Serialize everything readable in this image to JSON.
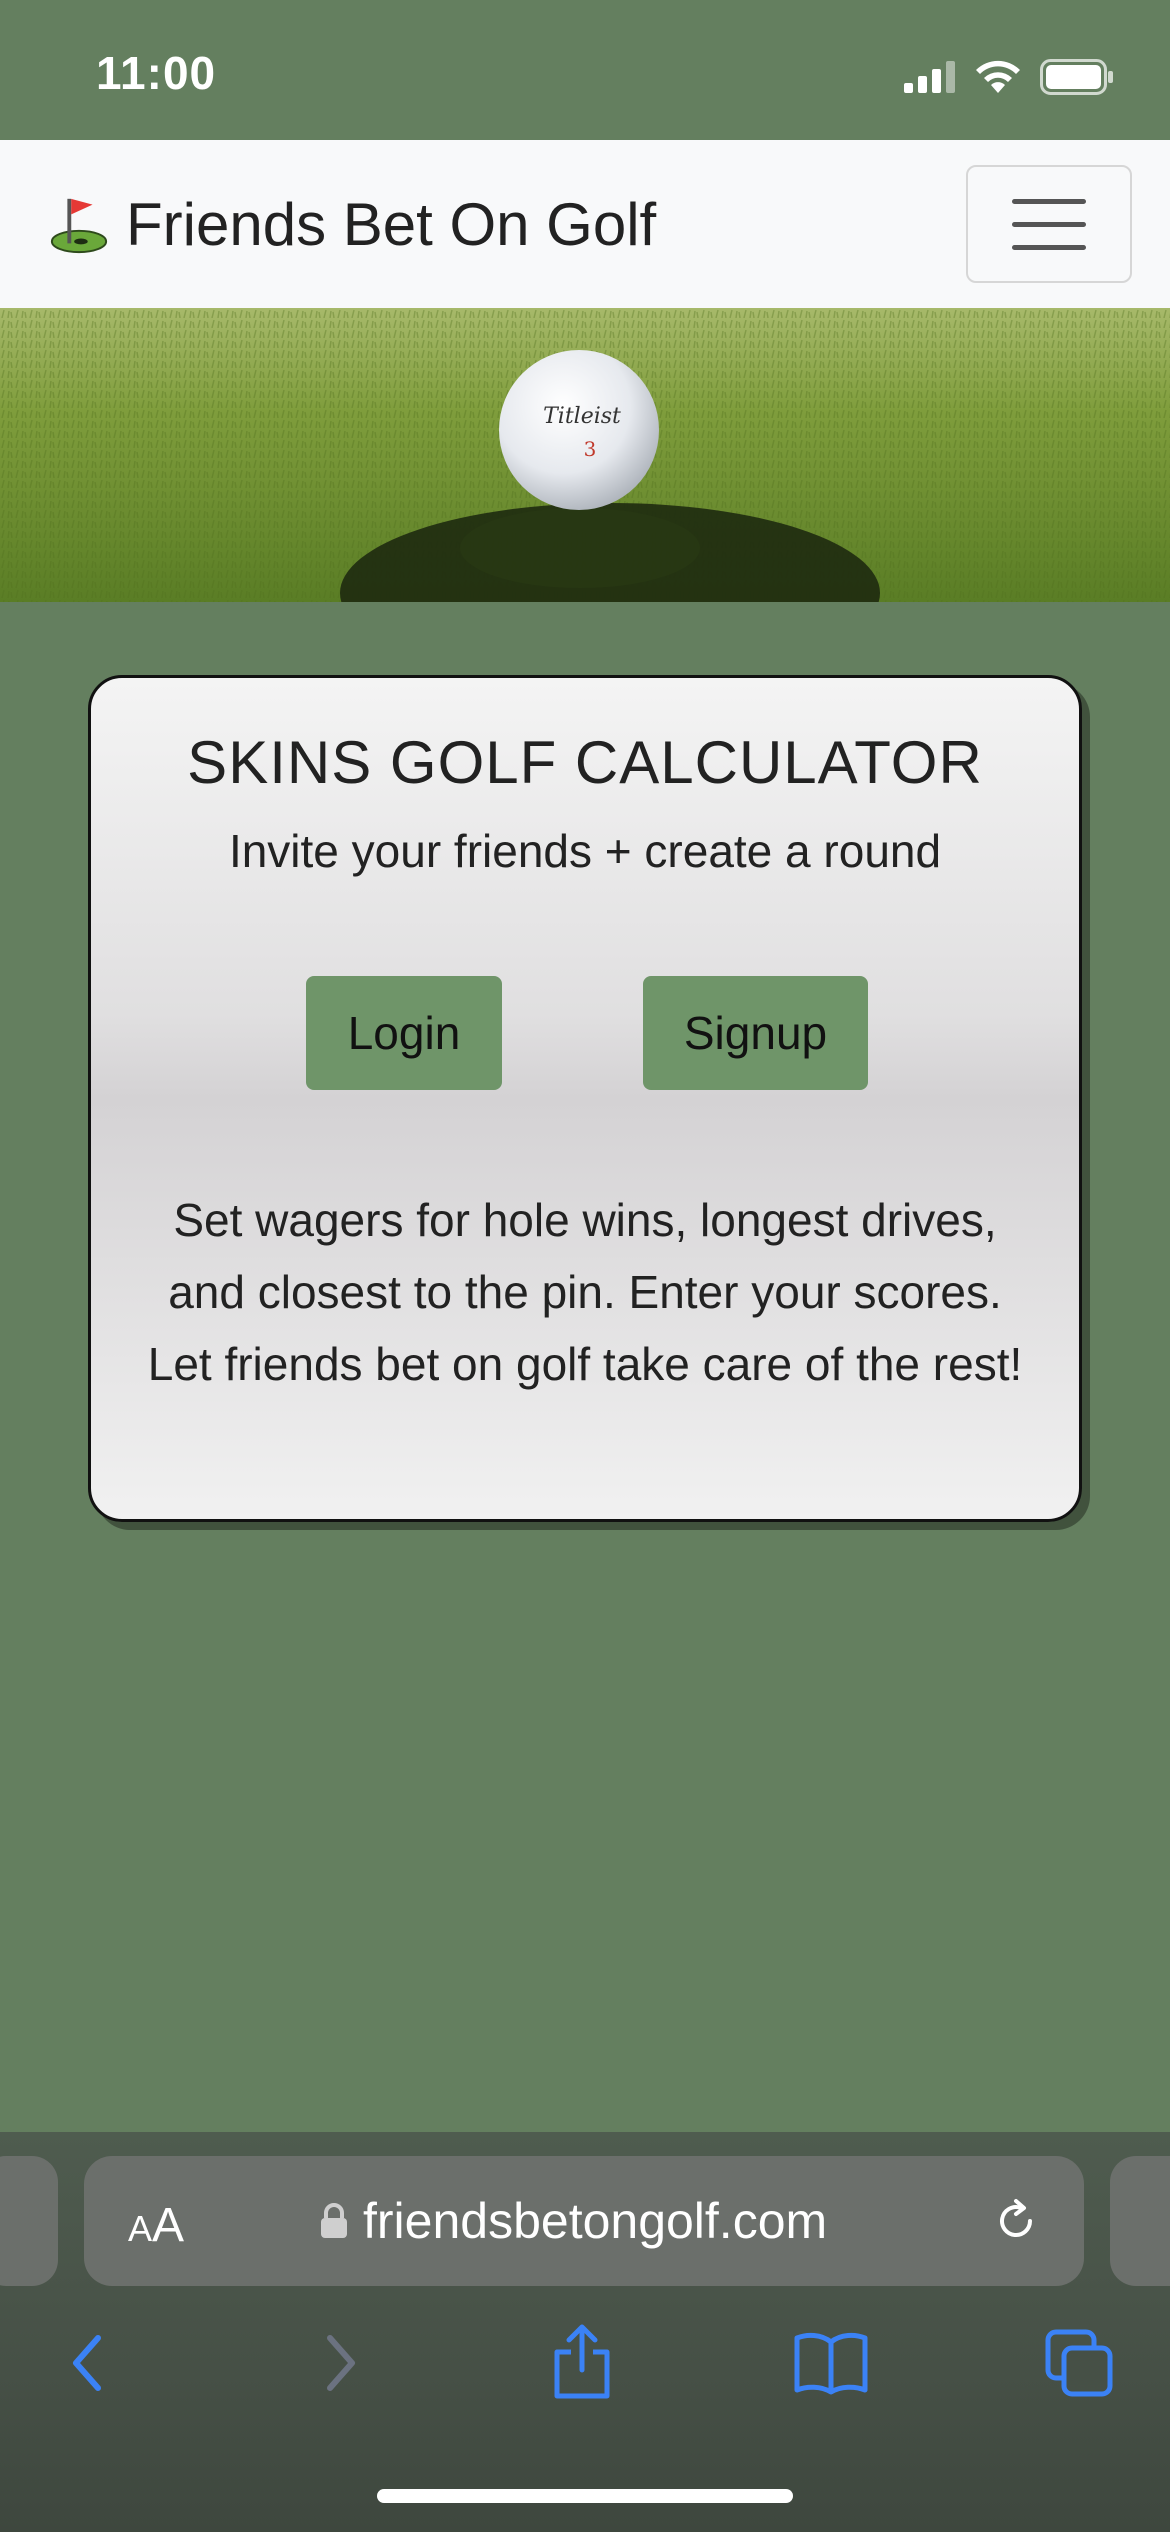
{
  "status_bar": {
    "time": "11:00",
    "icons": [
      "signal-icon",
      "wifi-icon",
      "battery-icon"
    ]
  },
  "navbar": {
    "brand_icon": "golf-flag-icon",
    "brand_text": "Friends Bet On Golf",
    "menu_icon": "hamburger-menu-icon"
  },
  "hero": {
    "image": "golf-ball-on-grass"
  },
  "card": {
    "title": "SKINS GOLF CALCULATOR",
    "subtitle": "Invite your friends + create a round",
    "login_label": "Login",
    "signup_label": "Signup",
    "description": "Set wagers for hole wins, longest drives, and closest to the pin. Enter your scores. Let friends bet on golf take care of the rest!"
  },
  "safari": {
    "text_size_small": "A",
    "text_size_large": "A",
    "url": "friendsbetongolf.com",
    "toolbar_icons": [
      "back-icon",
      "forward-icon",
      "share-icon",
      "bookmarks-icon",
      "tabs-icon"
    ]
  },
  "colors": {
    "page_background": "#647f5f",
    "navbar_background": "#f8f9fa",
    "button_background": "#6f9569",
    "safari_accent": "#3b82f6"
  }
}
